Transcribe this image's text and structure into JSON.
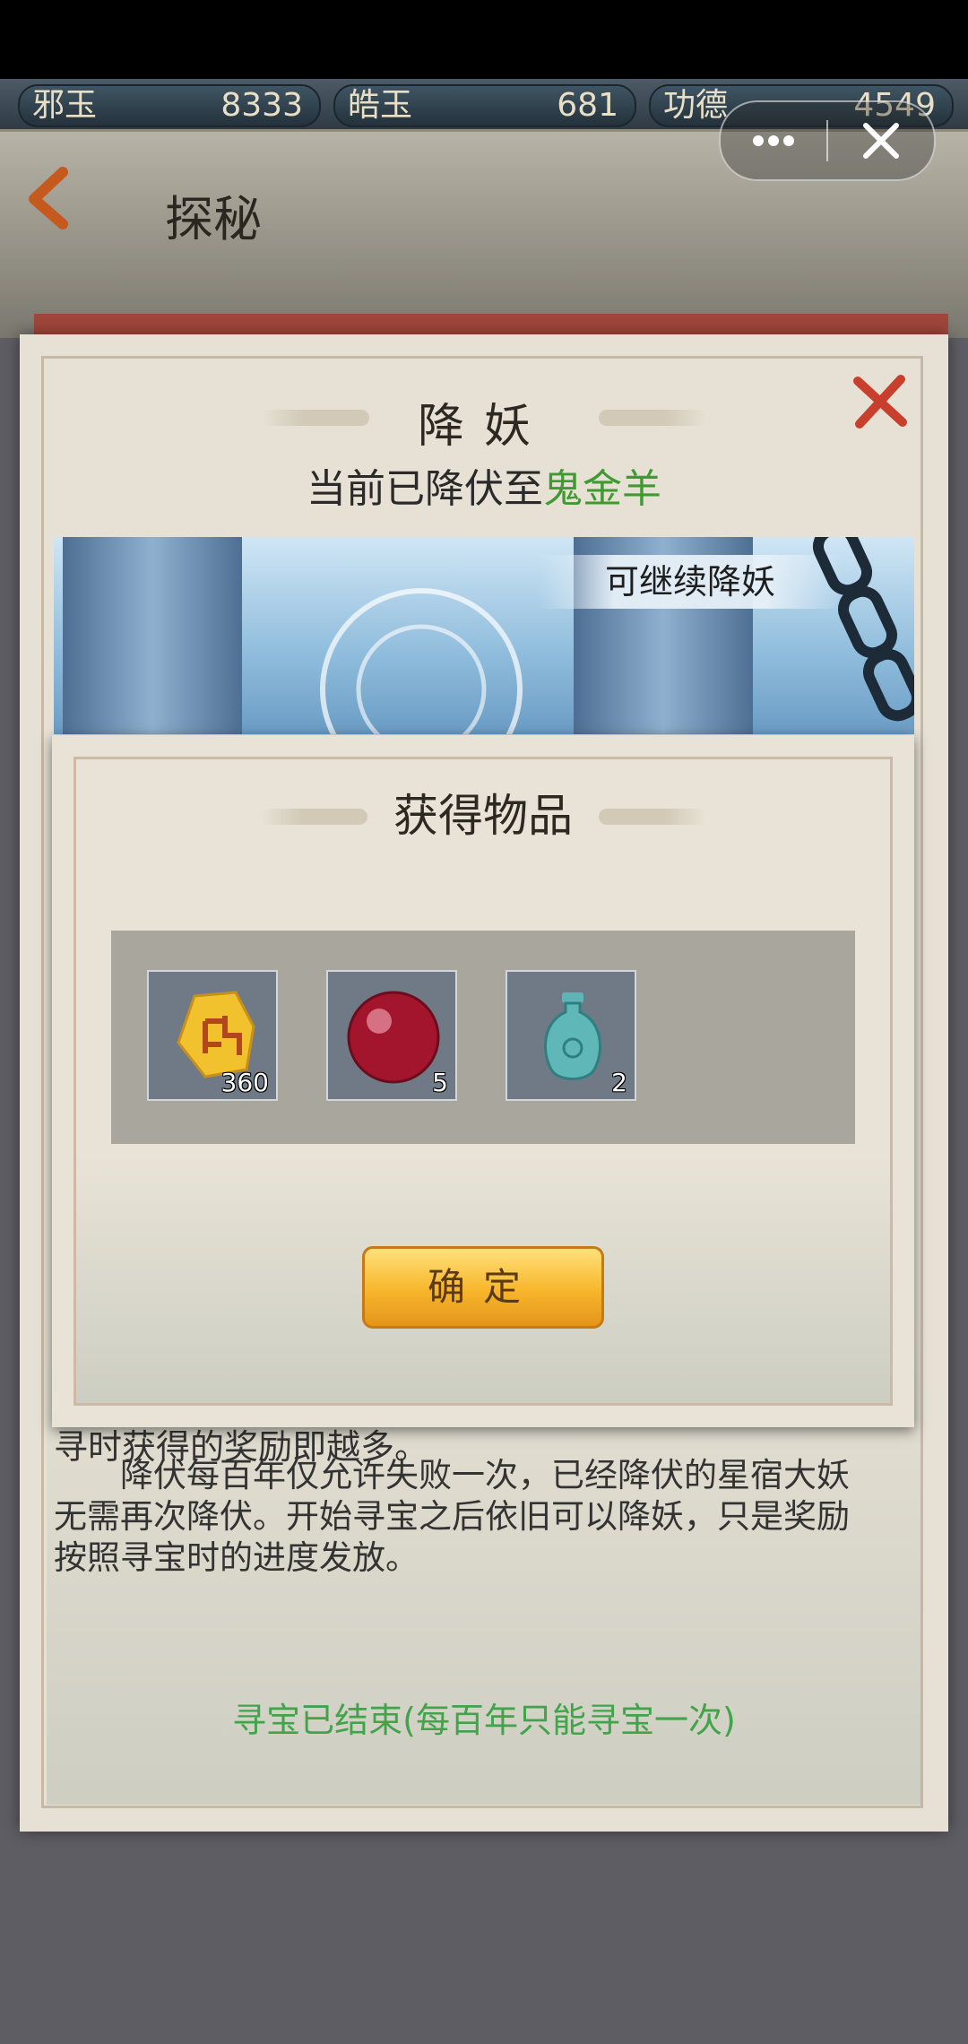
{
  "currency": [
    {
      "name": "邪玉",
      "value": "8333"
    },
    {
      "name": "皓玉",
      "value": "681"
    },
    {
      "name": "功德",
      "value": "4549"
    }
  ],
  "header": {
    "title": "探秘"
  },
  "dialog": {
    "title": "降妖",
    "status_prefix": "当前已降伏至",
    "status_monster": "鬼金羊",
    "banner_label": "可继续降妖",
    "desc_partial": "寻时获得的奖励即越多。",
    "desc_lines": [
      "　　降伏每百年仅允许失败一次，已经降伏的星宿大妖",
      "无需再次降伏。开始寻宝之后依旧可以降妖，只是奖励",
      "按照寻宝时的进度发放。"
    ],
    "footer_status": "寻宝已结束(每百年只能寻宝一次)"
  },
  "popup": {
    "title": "获得物品",
    "items": [
      {
        "icon": "gold-token-icon",
        "count": "360"
      },
      {
        "icon": "red-orb-icon",
        "count": "5"
      },
      {
        "icon": "jade-vase-icon",
        "count": "2"
      }
    ],
    "confirm_label": "确定"
  },
  "colors": {
    "accent_green": "#3f9a32",
    "confirm_gold": "#f7b52b",
    "close_red": "#c8402d"
  }
}
